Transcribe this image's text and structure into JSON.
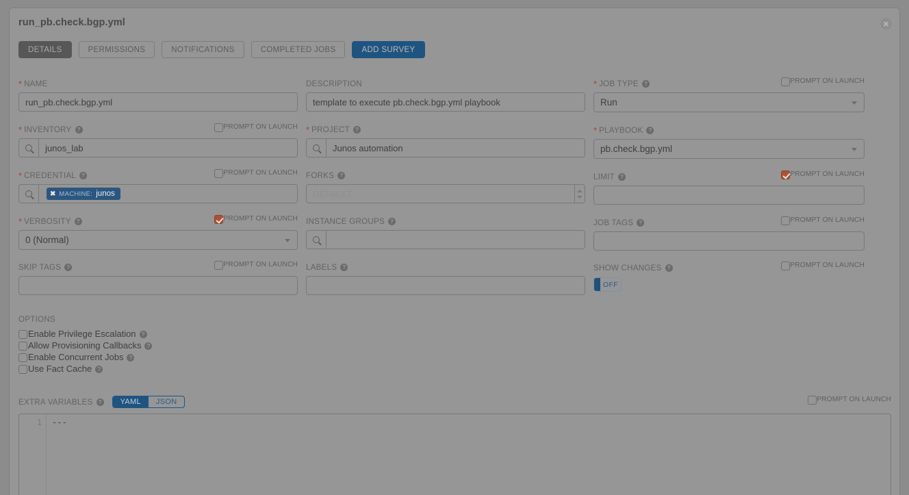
{
  "modal": {
    "title": "run_pb.check.bgp.yml",
    "close_icon": "close-icon"
  },
  "tabs": [
    {
      "label": "DETAILS",
      "state": "active"
    },
    {
      "label": "PERMISSIONS",
      "state": "plain"
    },
    {
      "label": "NOTIFICATIONS",
      "state": "plain"
    },
    {
      "label": "COMPLETED JOBS",
      "state": "plain"
    },
    {
      "label": "ADD SURVEY",
      "state": "primary"
    }
  ],
  "prompt_on_launch_label": "PROMPT ON LAUNCH",
  "fields": {
    "name": {
      "label": "NAME",
      "value": "run_pb.check.bgp.yml"
    },
    "description": {
      "label": "DESCRIPTION",
      "value": "template to execute pb.check.bgp.yml playbook"
    },
    "job_type": {
      "label": "JOB TYPE",
      "value": "Run"
    },
    "inventory": {
      "label": "INVENTORY",
      "value": "junos_lab"
    },
    "project": {
      "label": "PROJECT",
      "value": "Junos automation"
    },
    "playbook": {
      "label": "PLAYBOOK",
      "value": "pb.check.bgp.yml"
    },
    "credential": {
      "label": "CREDENTIAL",
      "tag_kind": "MACHINE:",
      "tag_value": "junos",
      "tag_remove": "✖"
    },
    "forks": {
      "label": "FORKS",
      "placeholder": "DEFAULT",
      "value": ""
    },
    "limit": {
      "label": "LIMIT",
      "value": ""
    },
    "verbosity": {
      "label": "VERBOSITY",
      "value": "0 (Normal)"
    },
    "instance_groups": {
      "label": "INSTANCE GROUPS",
      "value": ""
    },
    "job_tags": {
      "label": "JOB TAGS",
      "value": ""
    },
    "skip_tags": {
      "label": "SKIP TAGS",
      "value": ""
    },
    "labels": {
      "label": "LABELS",
      "value": ""
    },
    "show_changes": {
      "label": "SHOW CHANGES",
      "toggle_state": "OFF"
    }
  },
  "options": {
    "header": "OPTIONS",
    "items": [
      {
        "label": "Enable Privilege Escalation",
        "checked": false
      },
      {
        "label": "Allow Provisioning Callbacks",
        "checked": false
      },
      {
        "label": "Enable Concurrent Jobs",
        "checked": false
      },
      {
        "label": "Use Fact Cache",
        "checked": false
      }
    ]
  },
  "extra_variables": {
    "label": "EXTRA VARIABLES",
    "format_yaml": "YAML",
    "format_json": "JSON",
    "selected_format": "YAML",
    "line_number": "1",
    "content": "---"
  },
  "colors": {
    "background": "#969696",
    "accent_blue": "#1f5481",
    "checked_orange": "#ad5232",
    "required_red": "#a34334",
    "tag_blue": "#2b5680",
    "active_tab": "#575757"
  }
}
